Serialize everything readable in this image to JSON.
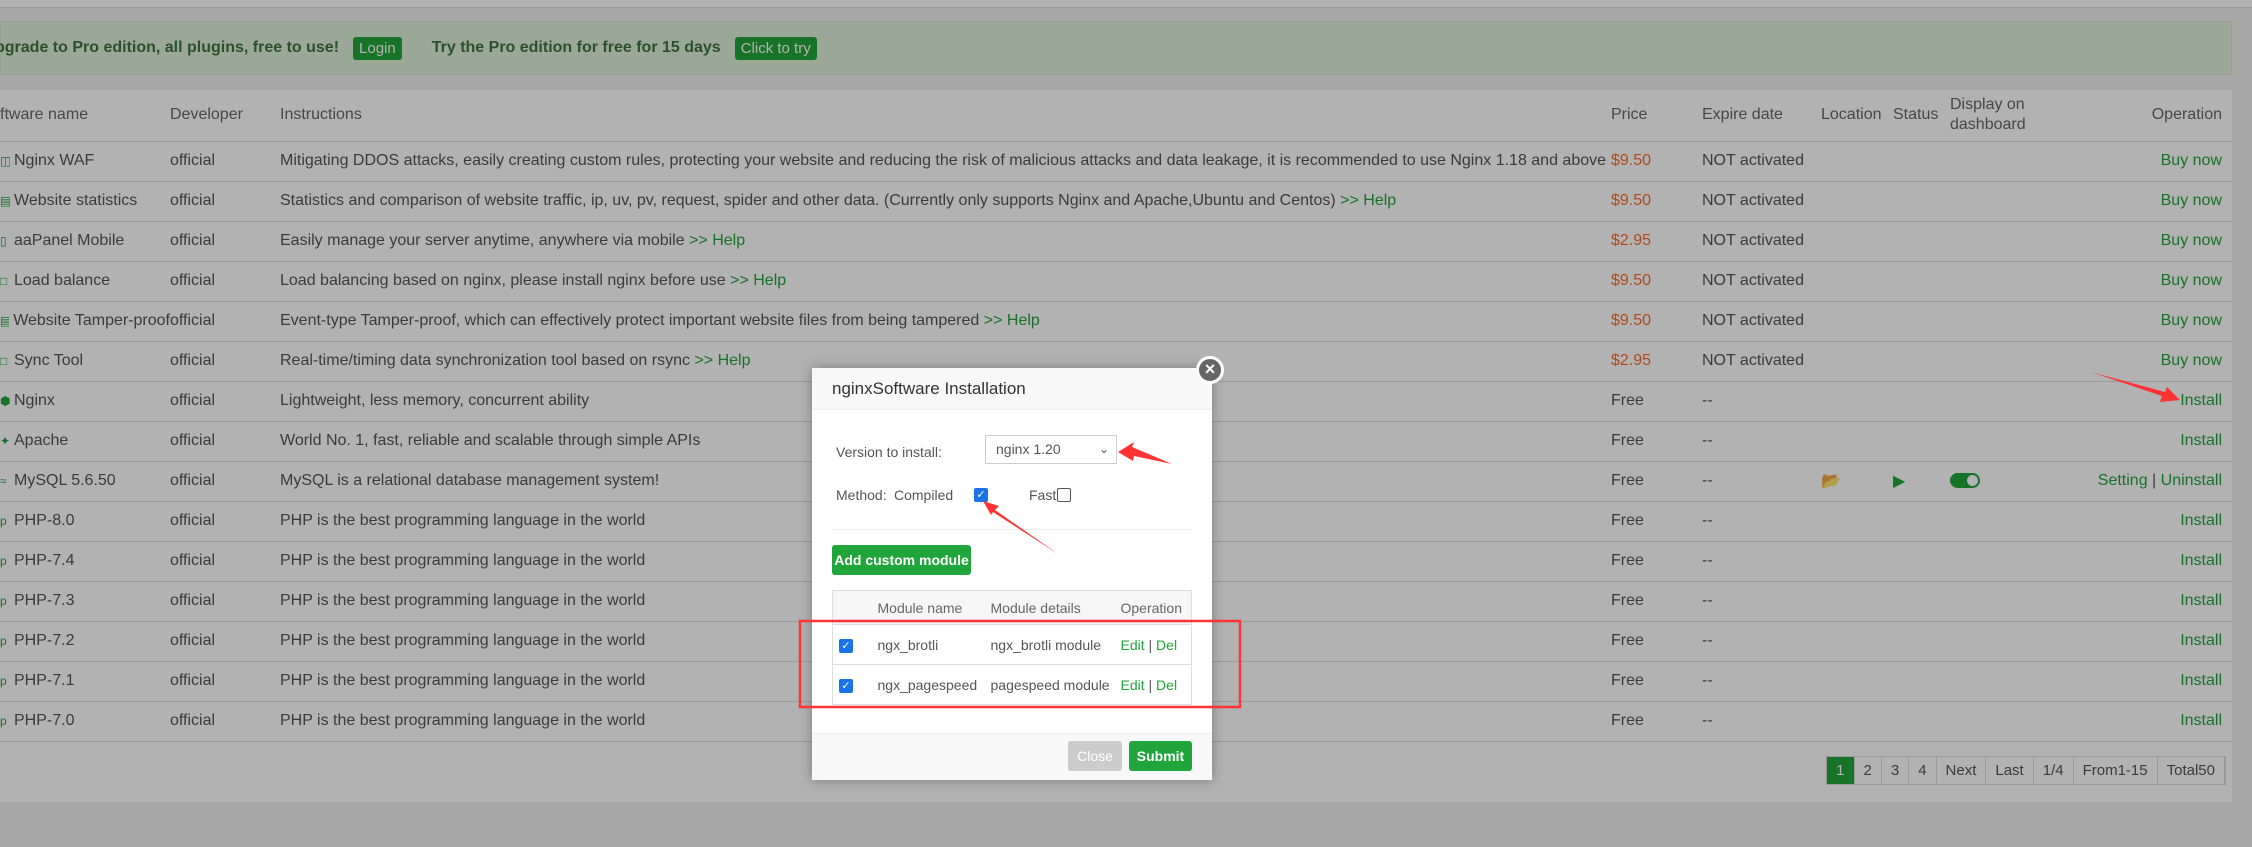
{
  "banner": {
    "upgrade_text": "pgrade to Pro edition, all plugins, free to use!",
    "login_label": "Login",
    "trial_text": "Try the Pro edition for free for 15 days",
    "try_label": "Click to try"
  },
  "table": {
    "headers": {
      "name": "ftware name",
      "developer": "Developer",
      "instructions": "Instructions",
      "price": "Price",
      "expire": "Expire date",
      "location": "Location",
      "status": "Status",
      "display": "Display on dashboard",
      "operation": "Operation"
    },
    "help_label": ">> Help",
    "rows": [
      {
        "name": "Nginx WAF",
        "developer": "official",
        "instructions": "Mitigating DDOS attacks, easily creating custom rules, protecting your website and reducing the risk of malicious attacks and data leakage, it is recommended to use Nginx 1.18 and above",
        "price": "$9.50",
        "expire": "NOT activated",
        "op": "Buy now"
      },
      {
        "name": "Website statistics",
        "developer": "official",
        "instructions": "Statistics and comparison of website traffic, ip, uv, pv, request, spider and other data. (Currently only supports Nginx and Apache,Ubuntu and Centos)",
        "price": "$9.50",
        "expire": "NOT activated",
        "op": "Buy now"
      },
      {
        "name": "aaPanel Mobile",
        "developer": "official",
        "instructions": "Easily manage your server anytime, anywhere via mobile",
        "price": "$2.95",
        "expire": "NOT activated",
        "op": "Buy now"
      },
      {
        "name": "Load balance",
        "developer": "official",
        "instructions": "Load balancing based on nginx, please install nginx before use",
        "price": "$9.50",
        "expire": "NOT activated",
        "op": "Buy now"
      },
      {
        "name": "Website Tamper-proof",
        "developer": "official",
        "instructions": "Event-type Tamper-proof, which can effectively protect important website files from being tampered",
        "price": "$9.50",
        "expire": "NOT activated",
        "op": "Buy now"
      },
      {
        "name": "Sync Tool",
        "developer": "official",
        "instructions": "Real-time/timing data synchronization tool based on rsync",
        "price": "$2.95",
        "expire": "NOT activated",
        "op": "Buy now"
      },
      {
        "name": "Nginx",
        "developer": "official",
        "instructions": "Lightweight, less memory, concurrent ability",
        "price": "Free",
        "expire": "--",
        "op": "Install"
      },
      {
        "name": "Apache",
        "developer": "official",
        "instructions": "World No. 1, fast, reliable and scalable through simple APIs",
        "price": "Free",
        "expire": "--",
        "op": "Install"
      },
      {
        "name": "MySQL 5.6.50",
        "developer": "official",
        "instructions": "MySQL is a relational database management system!",
        "price": "Free",
        "expire": "--",
        "op": "Setting",
        "op2": "Uninstall"
      },
      {
        "name": "PHP-8.0",
        "developer": "official",
        "instructions": "PHP is the best programming language in the world",
        "price": "Free",
        "expire": "--",
        "op": "Install"
      },
      {
        "name": "PHP-7.4",
        "developer": "official",
        "instructions": "PHP is the best programming language in the world",
        "price": "Free",
        "expire": "--",
        "op": "Install"
      },
      {
        "name": "PHP-7.3",
        "developer": "official",
        "instructions": "PHP is the best programming language in the world",
        "price": "Free",
        "expire": "--",
        "op": "Install"
      },
      {
        "name": "PHP-7.2",
        "developer": "official",
        "instructions": "PHP is the best programming language in the world",
        "price": "Free",
        "expire": "--",
        "op": "Install"
      },
      {
        "name": "PHP-7.1",
        "developer": "official",
        "instructions": "PHP is the best programming language in the world",
        "price": "Free",
        "expire": "--",
        "op": "Install"
      },
      {
        "name": "PHP-7.0",
        "developer": "official",
        "instructions": "PHP is the best programming language in the world",
        "price": "Free",
        "expire": "--",
        "op": "Install"
      }
    ]
  },
  "pagination": {
    "pages": [
      "1",
      "2",
      "3",
      "4"
    ],
    "next": "Next",
    "last": "Last",
    "page_of": "1/4",
    "range": "From1-15",
    "total": "Total50"
  },
  "modal": {
    "title": "nginxSoftware Installation",
    "version_label": "Version to install:",
    "version_value": "nginx 1.20",
    "method_label": "Method:",
    "compiled_label": "Compiled",
    "compiled_checked": true,
    "fast_label": "Fast",
    "fast_checked": false,
    "add_module_label": "Add custom module",
    "module_headers": {
      "name": "Module name",
      "details": "Module details",
      "operation": "Operation"
    },
    "modules": [
      {
        "name": "ngx_brotli",
        "details": "ngx_brotli module",
        "edit": "Edit",
        "del": "Del",
        "checked": true
      },
      {
        "name": "ngx_pagespeed",
        "details": "pagespeed module",
        "edit": "Edit",
        "del": "Del",
        "checked": true
      }
    ],
    "close_label": "Close",
    "submit_label": "Submit"
  },
  "colors": {
    "accent": "#20a53a",
    "price": "#fc6d26",
    "annotation": "#ff3333"
  }
}
